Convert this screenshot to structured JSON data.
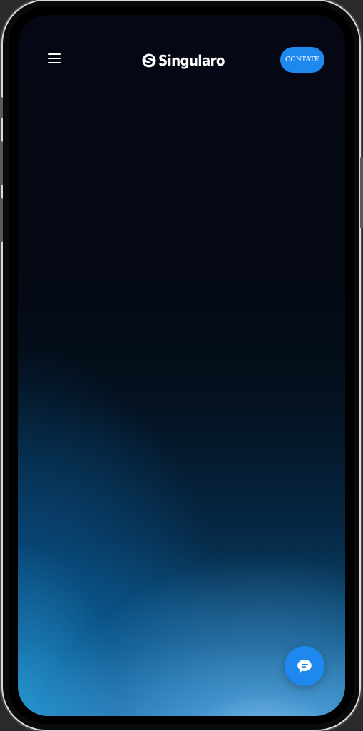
{
  "app": {
    "brand_name": "Singularo",
    "logo_icon": "singularo-s-logo-icon"
  },
  "header": {
    "menu_icon": "hamburger-menu-icon",
    "cta_label": "CONTATE"
  },
  "chat": {
    "icon": "chat-bubble-icon"
  },
  "colors": {
    "accent": "#1e88ee",
    "background_top": "#050814",
    "background_bottom": "#2e8fc8"
  }
}
